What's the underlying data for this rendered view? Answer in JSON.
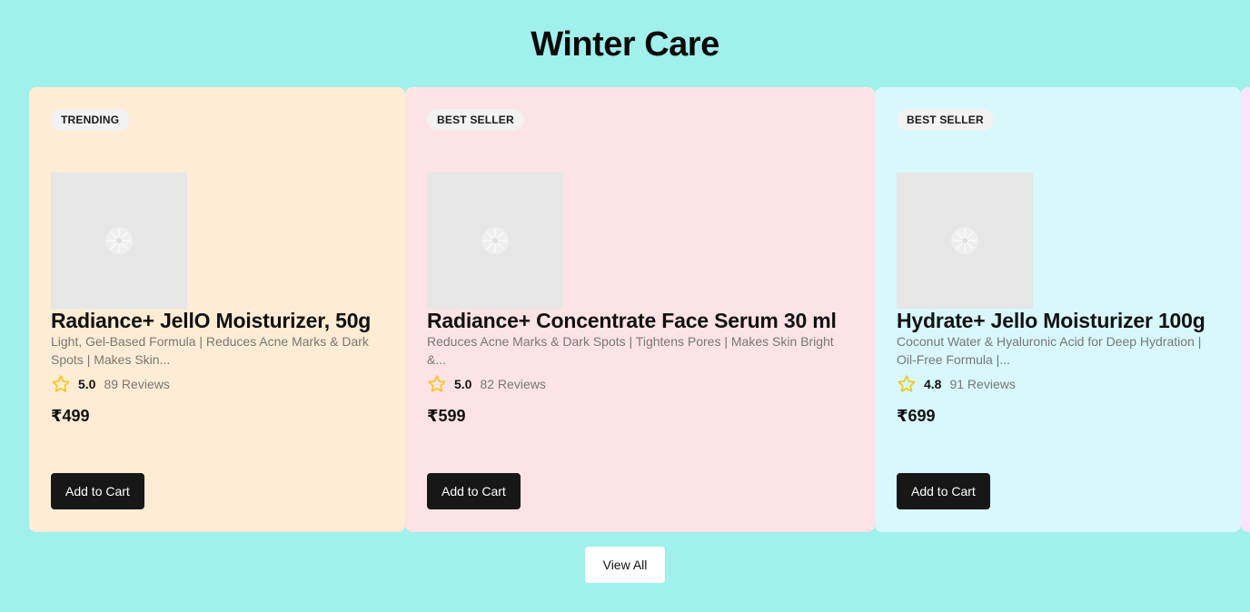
{
  "section": {
    "title": "Winter Care",
    "view_all_label": "View All"
  },
  "colors": {
    "page_bg": "#a0f0ec",
    "button_bg": "#171717",
    "star": "#f5c518"
  },
  "products": [
    {
      "badge": "TRENDING",
      "name": "Radiance+ JellO Moisturizer, 50g",
      "description": "Light, Gel-Based Formula | Reduces Acne Marks & Dark Spots | Makes Skin...",
      "rating": "5.0",
      "reviews": "89 Reviews",
      "price": "₹499",
      "cta": "Add to Cart",
      "card_color": "#ffecd4"
    },
    {
      "badge": "BEST SELLER",
      "name": "Radiance+ Concentrate Face Serum 30 ml",
      "description": "Reduces Acne Marks & Dark Spots | Tightens Pores | Makes Skin Bright &...",
      "rating": "5.0",
      "reviews": "82 Reviews",
      "price": "₹599",
      "cta": "Add to Cart",
      "card_color": "#fde3e5"
    },
    {
      "badge": "BEST SELLER",
      "name": "Hydrate+ Jello Moisturizer 100g",
      "description": "Coconut Water & Hyaluronic Acid for Deep Hydration | Oil-Free Formula |...",
      "rating": "4.8",
      "reviews": "91 Reviews",
      "price": "₹699",
      "cta": "Add to Cart",
      "card_color": "#d8f8fd"
    }
  ],
  "icons": {
    "rating": "star-outline-icon",
    "image_placeholder": "image-placeholder-icon"
  }
}
